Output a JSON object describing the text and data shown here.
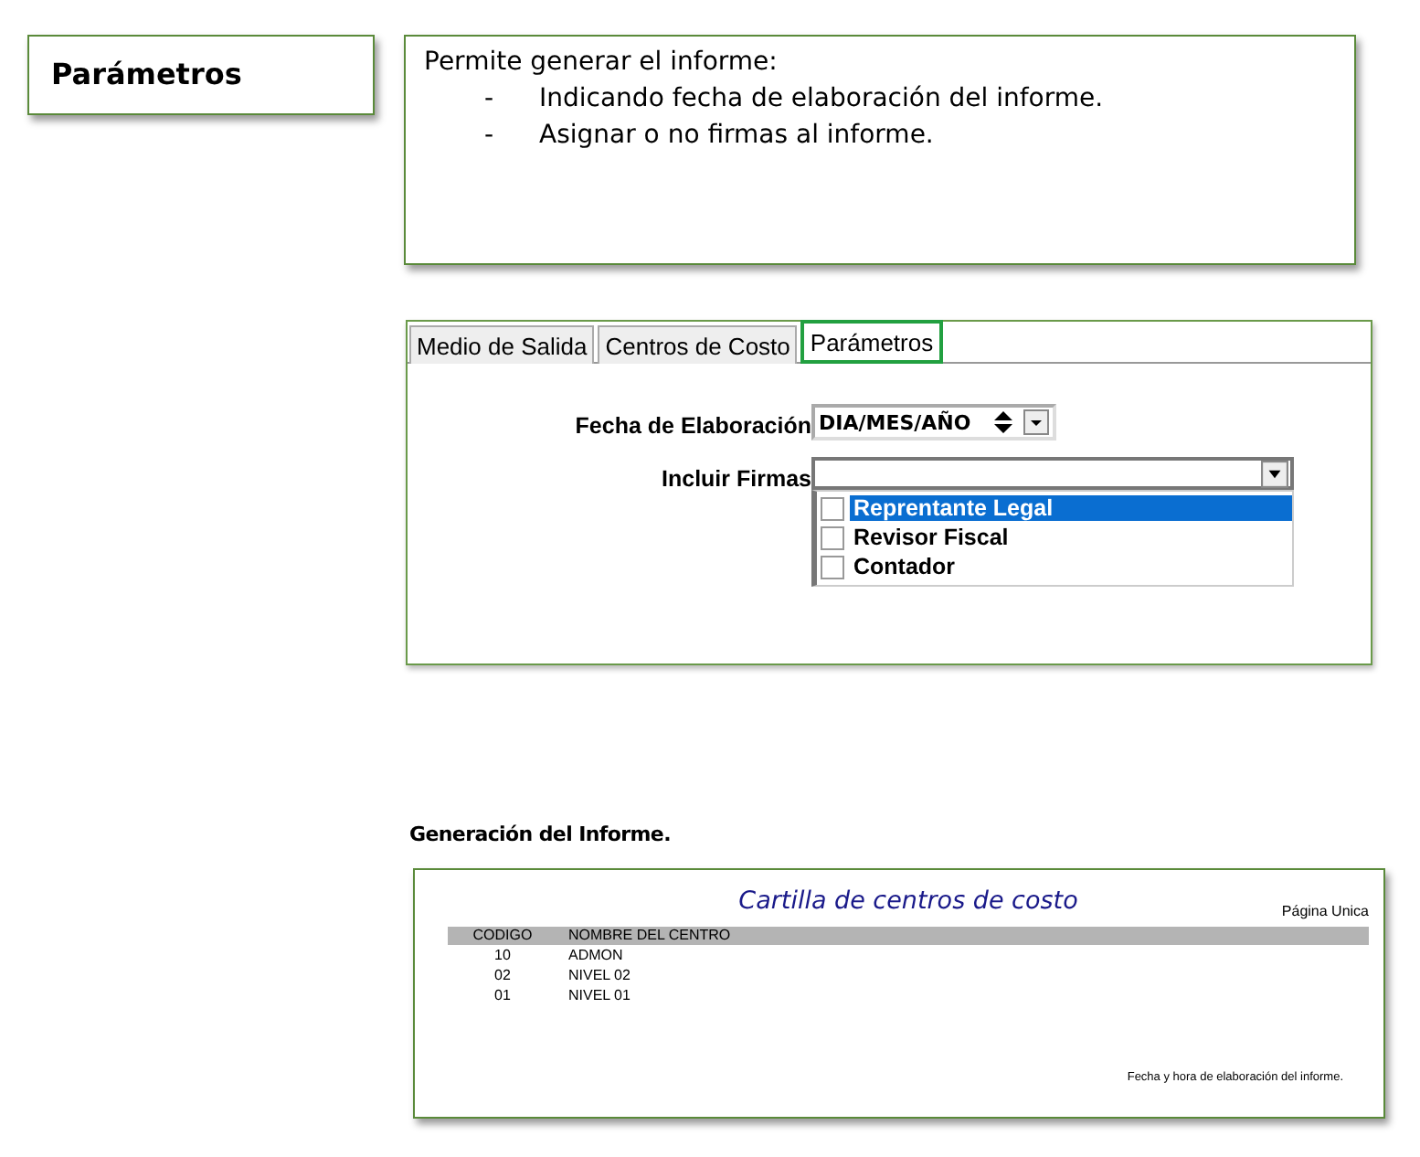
{
  "section_title": "Parámetros",
  "description": {
    "intro": "Permite generar el informe:",
    "items": [
      {
        "marker": "-",
        "text": "Indicando fecha de elaboración del informe."
      },
      {
        "marker": "-",
        "text": "Asignar o no firmas al informe."
      }
    ]
  },
  "tabs": [
    {
      "label": "Medio de Salida",
      "selected": false
    },
    {
      "label": "Centros de Costo",
      "selected": false
    },
    {
      "label": "Parámetros",
      "selected": true
    }
  ],
  "date_field": {
    "label": "Fecha de Elaboración",
    "value": "DIA/MES/AÑO"
  },
  "signatures": {
    "label": "Incluir Firmas",
    "expanded": true,
    "options": [
      {
        "label": "Reprentante Legal",
        "checked": false,
        "selected": true
      },
      {
        "label": "Revisor Fiscal",
        "checked": false,
        "selected": false
      },
      {
        "label": "Contador",
        "checked": false,
        "selected": false
      }
    ]
  },
  "report_heading": "Generación del Informe.",
  "report": {
    "title": "Cartilla de centros de costo",
    "page_label": "Página Unica",
    "columns": [
      "CODIGO",
      "NOMBRE DEL CENTRO"
    ],
    "rows": [
      [
        "10",
        "ADMON"
      ],
      [
        "02",
        "NIVEL 02"
      ],
      [
        "01",
        "NIVEL 01"
      ]
    ],
    "footer": "Fecha y hora de elaboración del informe."
  }
}
